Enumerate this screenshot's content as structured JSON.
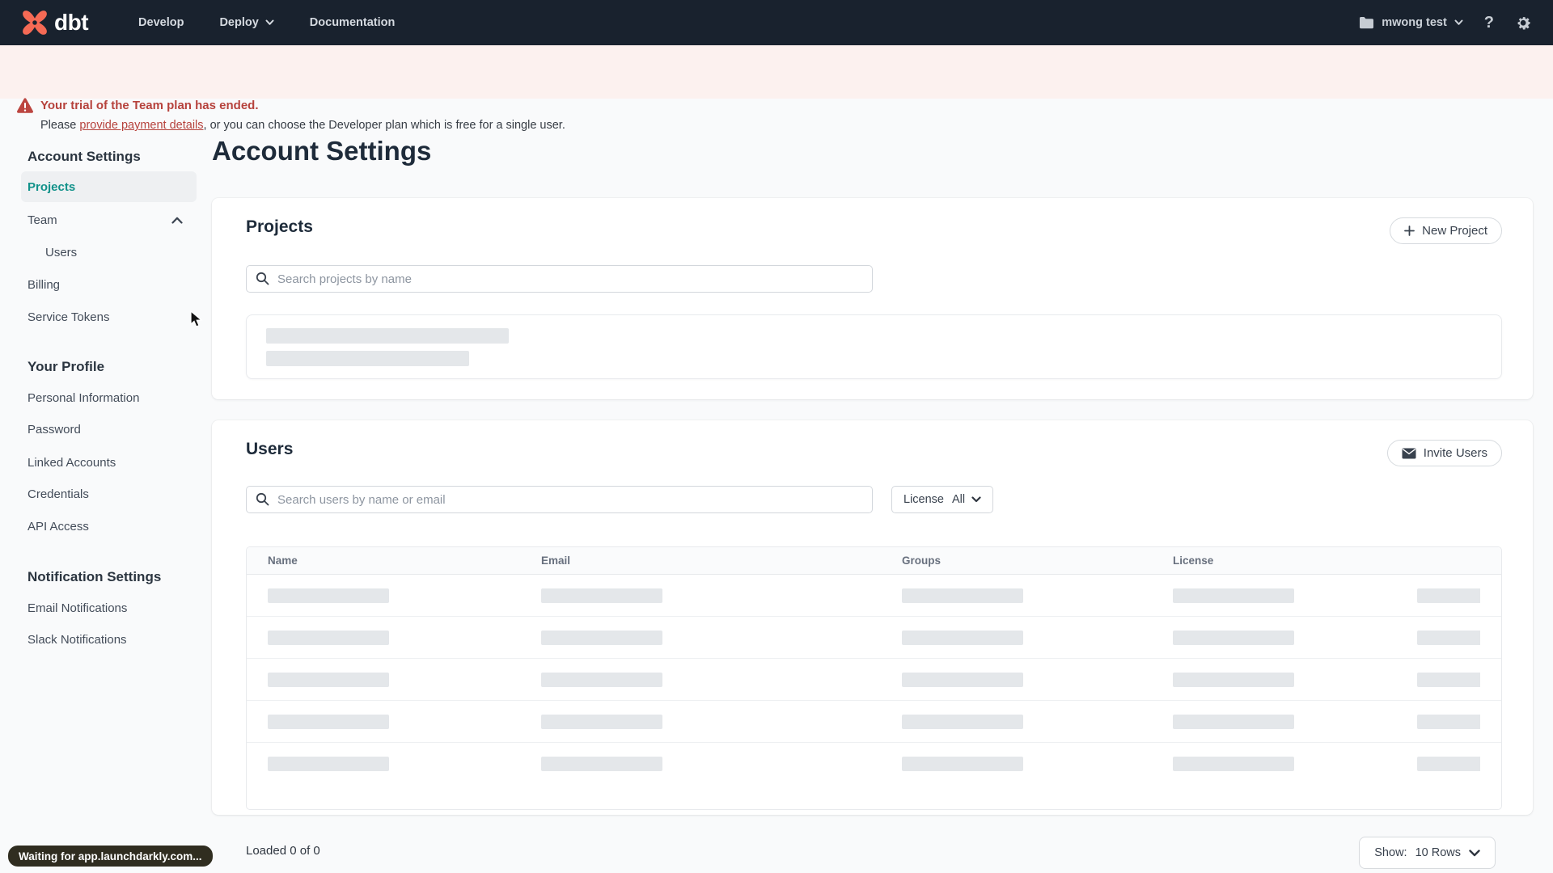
{
  "nav": {
    "brand": "dbt",
    "items": [
      {
        "label": "Develop"
      },
      {
        "label": "Deploy"
      },
      {
        "label": "Documentation"
      }
    ],
    "account_label": "mwong test",
    "help_glyph": "?"
  },
  "banner": {
    "title": "Your trial of the Team plan has ended.",
    "body_prefix": "Please ",
    "link_text": "provide payment details",
    "body_suffix": ", or you can choose the Developer plan which is free for a single user."
  },
  "sidebar": {
    "sections": [
      {
        "heading": "Account Settings",
        "items": [
          {
            "label": "Projects",
            "active": true
          },
          {
            "label": "Team",
            "expanded": true
          },
          {
            "label": "Users",
            "child": true
          },
          {
            "label": "Billing"
          },
          {
            "label": "Service Tokens"
          }
        ]
      },
      {
        "heading": "Your Profile",
        "items": [
          {
            "label": "Personal Information"
          },
          {
            "label": "Password"
          },
          {
            "label": "Linked Accounts"
          },
          {
            "label": "Credentials"
          },
          {
            "label": "API Access"
          }
        ]
      },
      {
        "heading": "Notification Settings",
        "items": [
          {
            "label": "Email Notifications"
          },
          {
            "label": "Slack Notifications"
          }
        ]
      }
    ]
  },
  "main": {
    "page_title": "Account Settings",
    "projects_card": {
      "title": "Projects",
      "new_project_button": "New Project",
      "search_placeholder": "Search projects by name"
    },
    "users_card": {
      "title": "Users",
      "invite_users_button": "Invite Users",
      "search_placeholder": "Search users by name or email",
      "license_filter": {
        "label": "License",
        "value": "All"
      },
      "table": {
        "columns": [
          "Name",
          "Email",
          "Groups",
          "License"
        ],
        "skeleton_row_count": 5
      }
    },
    "footer": {
      "loaded_text": "Loaded 0 of 0",
      "show_label": "Show:",
      "show_value": "10 Rows"
    }
  },
  "status_bubble": {
    "text": "Waiting for app.launchdarkly.com..."
  },
  "colors": {
    "nav_bg": "#19222e",
    "brand_orange": "#f56a55",
    "banner_bg": "#fcf1ef",
    "banner_red": "#b6423c",
    "active_teal": "#11928a",
    "skeleton_gray": "#e4e7ea"
  }
}
